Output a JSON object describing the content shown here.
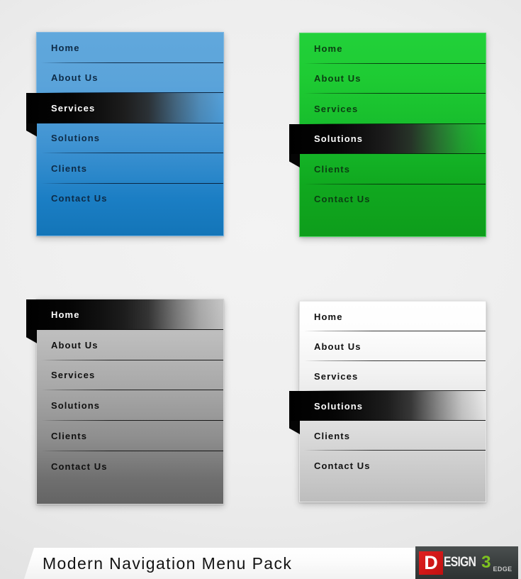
{
  "page": {
    "background_color": "#ececec",
    "title": "Modern Navigation Menu Pack"
  },
  "menus": [
    {
      "id": "blue",
      "name": "blue-navigation-menu",
      "theme_color": "#3f93d2",
      "active_index": 2,
      "items": [
        {
          "label": "Home"
        },
        {
          "label": "About Us"
        },
        {
          "label": "Services"
        },
        {
          "label": "Solutions"
        },
        {
          "label": "Clients"
        },
        {
          "label": "Contact Us"
        }
      ]
    },
    {
      "id": "green",
      "name": "green-navigation-menu",
      "theme_color": "#17bc2c",
      "active_index": 3,
      "items": [
        {
          "label": "Home"
        },
        {
          "label": "About Us"
        },
        {
          "label": "Services"
        },
        {
          "label": "Solutions"
        },
        {
          "label": "Clients"
        },
        {
          "label": "Contact Us"
        }
      ]
    },
    {
      "id": "gray",
      "name": "gray-navigation-menu",
      "theme_color": "#a9a9a9",
      "active_index": 0,
      "items": [
        {
          "label": "Home"
        },
        {
          "label": "About Us"
        },
        {
          "label": "Services"
        },
        {
          "label": "Solutions"
        },
        {
          "label": "Clients"
        },
        {
          "label": "Contact Us"
        }
      ]
    },
    {
      "id": "white",
      "name": "white-navigation-menu",
      "theme_color": "#e3e3e3",
      "active_index": 3,
      "items": [
        {
          "label": "Home"
        },
        {
          "label": "About Us"
        },
        {
          "label": "Services"
        },
        {
          "label": "Solutions"
        },
        {
          "label": "Clients"
        },
        {
          "label": "Contact Us"
        }
      ]
    }
  ],
  "footer": {
    "title": "Modern Navigation Menu Pack",
    "logo": {
      "mark": "D",
      "word": "ESIGN",
      "number": "3",
      "suffix": "EDGE",
      "mark_color": "#d41a1a",
      "number_color": "#7ec220",
      "background_color": "#3c4141"
    }
  }
}
